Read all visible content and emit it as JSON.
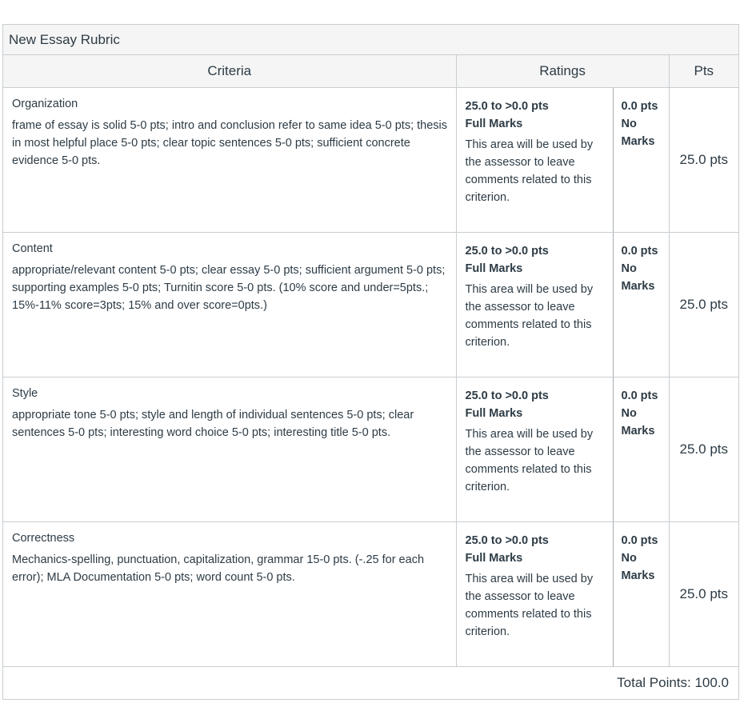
{
  "rubric": {
    "title": "New Essay Rubric",
    "headers": {
      "criteria": "Criteria",
      "ratings": "Ratings",
      "pts": "Pts"
    },
    "rows": [
      {
        "name": "Organization",
        "description": "frame of essay is solid 5-0 pts; intro and conclusion refer to same idea 5-0 pts; thesis in most helpful place 5-0 pts; clear topic sentences 5-0 pts; sufficient concrete evidence 5-0 pts.",
        "rating1_pts": "25.0 to >0.0 pts",
        "rating1_label": "Full Marks",
        "rating1_desc": "This area will be used by the assessor to leave comments related to this criterion.",
        "rating2_pts": "0.0 pts",
        "rating2_label": "No Marks",
        "points": "25.0 pts"
      },
      {
        "name": "Content",
        "description": "appropriate/relevant content 5-0 pts; clear essay 5-0 pts; sufficient argument 5-0 pts; supporting examples 5-0 pts; Turnitin score 5-0 pts. (10% score and under=5pts.; 15%-11% score=3pts; 15% and over score=0pts.)",
        "rating1_pts": "25.0 to >0.0 pts",
        "rating1_label": "Full Marks",
        "rating1_desc": "This area will be used by the assessor to leave comments related to this criterion.",
        "rating2_pts": "0.0 pts",
        "rating2_label": "No Marks",
        "points": "25.0 pts"
      },
      {
        "name": "Style",
        "description": "appropriate tone 5-0 pts; style and length of individual sentences 5-0 pts; clear sentences 5-0 pts; interesting word choice 5-0 pts; interesting title 5-0 pts.",
        "rating1_pts": "25.0 to >0.0 pts",
        "rating1_label": "Full Marks",
        "rating1_desc": "This area will be used by the assessor to leave comments related to this criterion.",
        "rating2_pts": "0.0 pts",
        "rating2_label": "No Marks",
        "points": "25.0 pts"
      },
      {
        "name": "Correctness",
        "description": "Mechanics-spelling, punctuation, capitalization, grammar 15-0 pts. (-.25 for each error); MLA Documentation 5-0 pts; word count 5-0 pts.",
        "rating1_pts": "25.0 to >0.0 pts",
        "rating1_label": "Full Marks",
        "rating1_desc": "This area will be used by the assessor to leave comments related to this criterion.",
        "rating2_pts": "0.0 pts",
        "rating2_label": "No Marks",
        "points": "25.0 pts"
      }
    ],
    "total": "Total Points: 100.0"
  }
}
